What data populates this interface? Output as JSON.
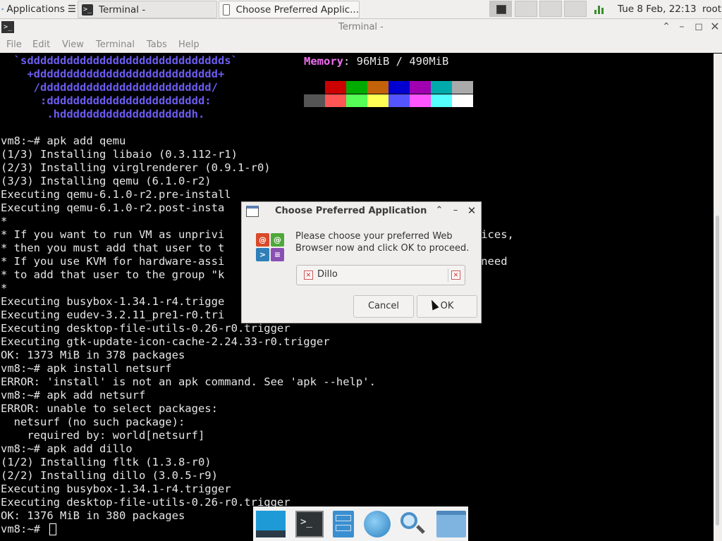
{
  "top_panel": {
    "applications_label": "Applications",
    "applications_glyph": "☰",
    "tasks": [
      {
        "label": "Terminal -"
      },
      {
        "label": "Choose Preferred Applic..."
      }
    ],
    "clock": "Tue  8 Feb, 22:13",
    "user": "root"
  },
  "terminal": {
    "title": "Terminal -",
    "menu": [
      "File",
      "Edit",
      "View",
      "Terminal",
      "Tabs",
      "Help"
    ],
    "neofetch_logo": [
      "  `sdddddddddddddddddddddddddddddds`",
      "    +dddddddddddddddddddddddddddd+",
      "     /dddddddddddddddddddddddddd/",
      "      :dddddddddddddddddddddddd:",
      "       .hddddddddddddddddddddh."
    ],
    "memory_key": "Memory",
    "memory_value": ": 96MiB / 490MiB",
    "palette_top": [
      "#000000",
      "#cc0000",
      "#00aa00",
      "#c4620a",
      "#0000d0",
      "#a000b0",
      "#00aaaa",
      "#aaaaaa"
    ],
    "palette_bottom": [
      "#555555",
      "#ff5555",
      "#55ff55",
      "#ffff55",
      "#5555ff",
      "#ff55ff",
      "#55ffff",
      "#ffffff"
    ],
    "lines": [
      "vm8:~# apk add qemu",
      "(1/3) Installing libaio (0.3.112-r1)",
      "(2/3) Installing virglrenderer (0.9.1-r0)",
      "(3/3) Installing qemu (6.1.0-r2)",
      "Executing qemu-6.1.0-r2.pre-install",
      "Executing qemu-6.1.0-r2.post-insta",
      "*",
      "* If you want to run VM as unprivi                                  X devices,",
      "* then you must add that user to t",
      "* If you use KVM for hardware-assi                                  also need",
      "* to add that user to the group \"k",
      "*",
      "Executing busybox-1.34.1-r4.trigge",
      "Executing eudev-3.2.11_pre1-r0.tri",
      "Executing desktop-file-utils-0.26-r0.trigger",
      "Executing gtk-update-icon-cache-2.24.33-r0.trigger",
      "OK: 1373 MiB in 378 packages",
      "vm8:~# apk install netsurf",
      "ERROR: 'install' is not an apk command. See 'apk --help'.",
      "vm8:~# apk add netsurf",
      "ERROR: unable to select packages:",
      "  netsurf (no such package):",
      "    required by: world[netsurf]",
      "vm8:~# apk add dillo",
      "(1/2) Installing fltk (1.3.8-r0)",
      "(2/2) Installing dillo (3.0.5-r9)",
      "Executing busybox-1.34.1-r4.trigger",
      "Executing desktop-file-utils-0.26-r0.trigger",
      "OK: 1376 MiB in 380 packages",
      "vm8:~# "
    ]
  },
  "dialog": {
    "title": "Choose Preferred Application",
    "message": "Please choose your preferred Web Browser now and click OK to proceed.",
    "selected_app": "Dillo",
    "cancel_label": "Cancel",
    "ok_label": "OK"
  },
  "dock": {
    "icons": [
      "desktop-icon",
      "terminal-icon",
      "file-cabinet-icon",
      "web-browser-icon",
      "search-icon",
      "folder-icon"
    ],
    "terminal_glyph": ">_"
  }
}
